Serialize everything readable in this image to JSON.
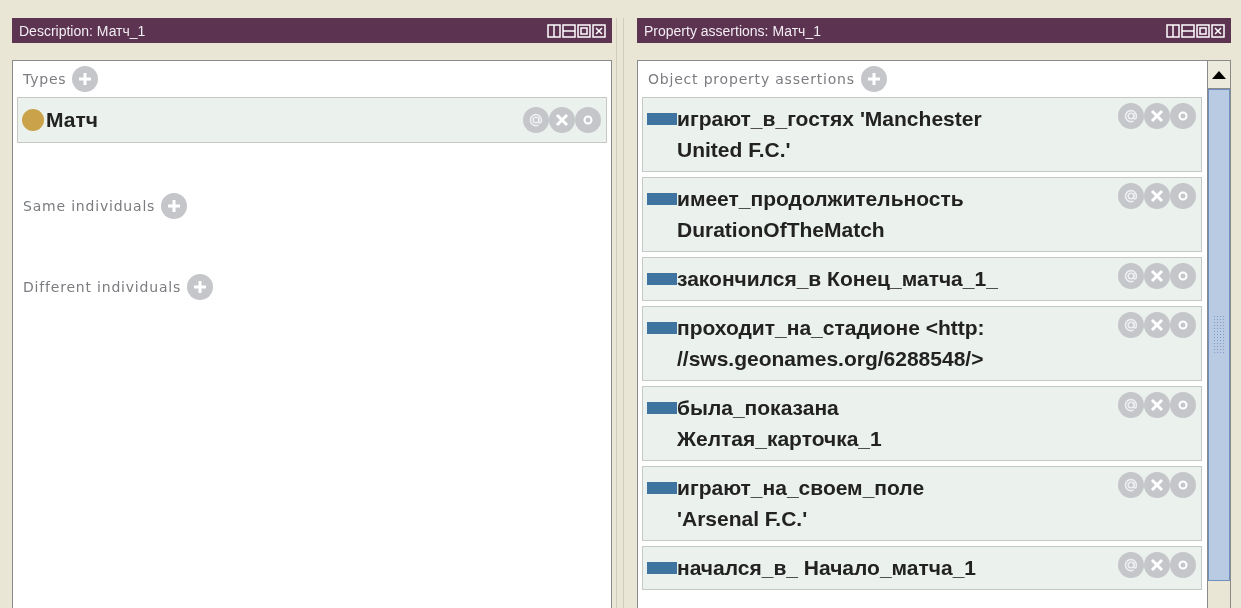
{
  "description_panel": {
    "title": "Description: Матч_1",
    "sections": [
      {
        "label": "Types",
        "items": [
          {
            "text": "Матч"
          }
        ]
      },
      {
        "label": "Same individuals"
      },
      {
        "label": "Different individuals"
      }
    ]
  },
  "property_panel": {
    "title": "Property assertions: Матч_1",
    "section": {
      "label": "Object property assertions"
    },
    "assertions": [
      {
        "lines": [
          "играют_в_гостях  'Manchester",
          "United F.C.'"
        ]
      },
      {
        "lines": [
          "имеет_продолжительность",
          "DurationOfTheMatch"
        ]
      },
      {
        "lines": [
          "закончился_в  Конец_матча_1_"
        ]
      },
      {
        "lines": [
          "проходит_на_стадионе  <http:",
          "//sws.geonames.org/6288548/>"
        ]
      },
      {
        "lines": [
          "была_показана",
          "Желтая_карточка_1"
        ]
      },
      {
        "lines": [
          "играют_на_своем_поле",
          "'Arsenal F.C.'"
        ]
      },
      {
        "lines": [
          "начался_в_  Начало_матча_1"
        ]
      }
    ]
  }
}
